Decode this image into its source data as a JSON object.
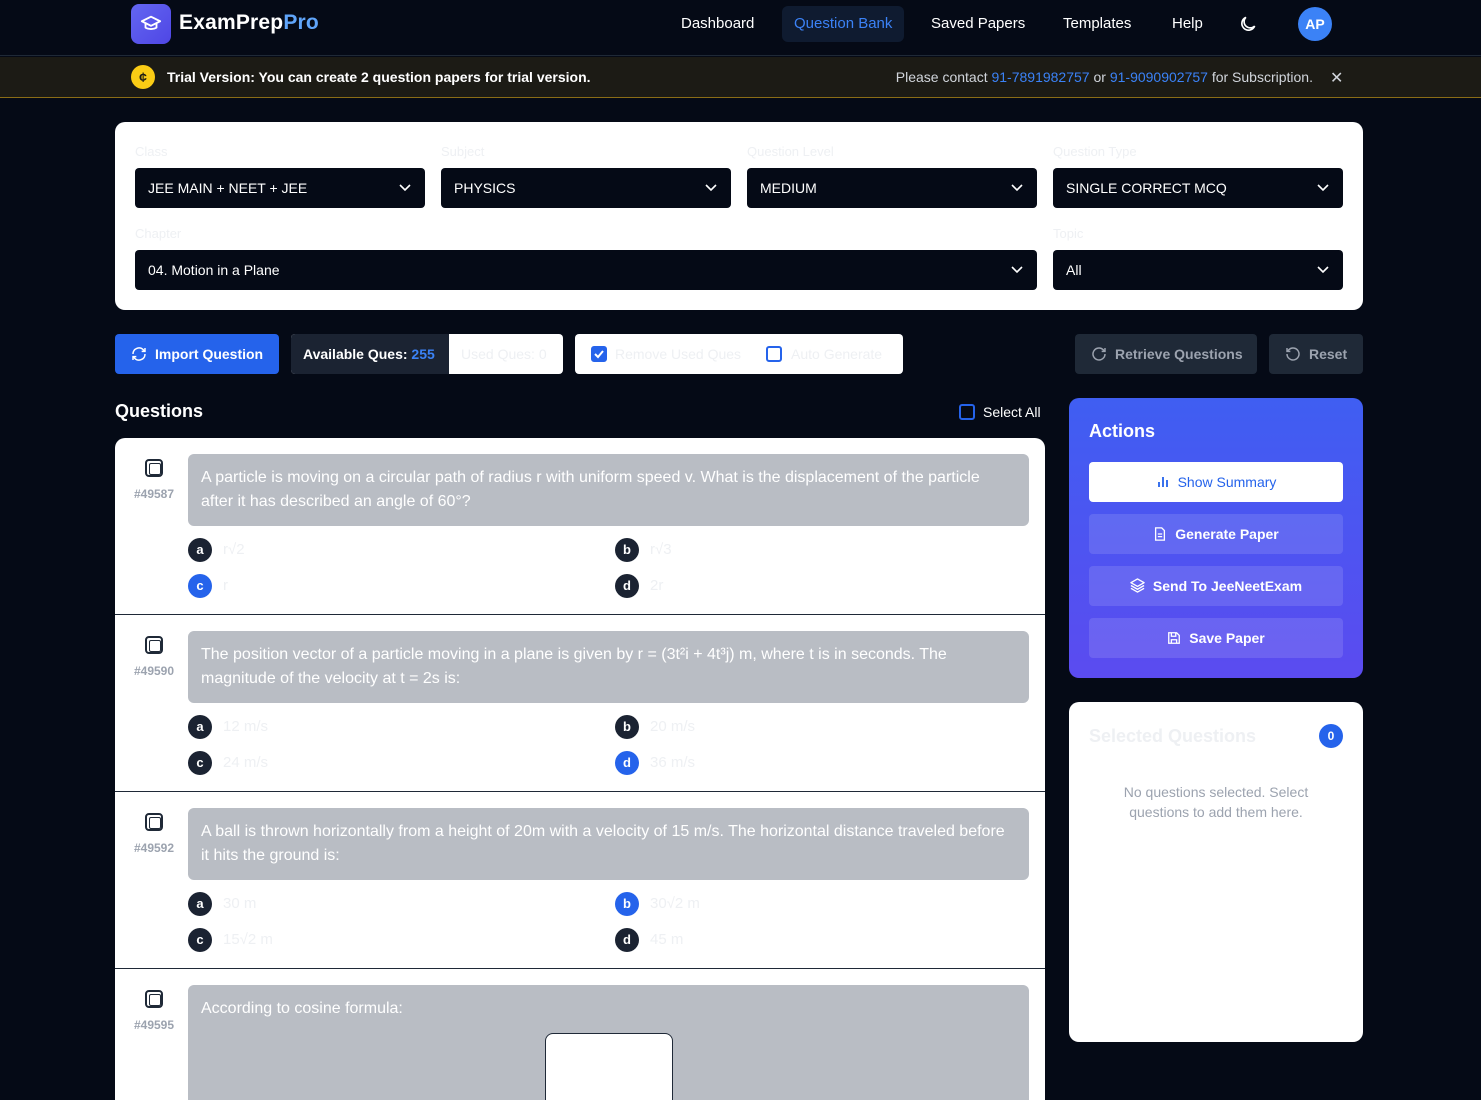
{
  "app": {
    "brand_main": "ExamPrep",
    "brand_accent": "Pro",
    "nav": [
      "Dashboard",
      "Question Bank",
      "Saved Papers",
      "Templates",
      "Help"
    ],
    "active_nav": "Question Bank",
    "avatar_initials": "AP"
  },
  "banner": {
    "icon": "coin-icon",
    "message": "Trial Version: You can create 2 question papers for trial version.",
    "contact_prefix": "Please contact ",
    "phone1": "91-7891982757",
    "contact_or": " or ",
    "phone2": "91-9090902757",
    "contact_suffix": " for Subscription."
  },
  "filters": {
    "class_label": "Class",
    "class_value": "JEE MAIN + NEET + JEE",
    "subject_label": "Subject",
    "subject_value": "PHYSICS",
    "level_label": "Question Level",
    "level_value": "MEDIUM",
    "type_label": "Question Type",
    "type_value": "SINGLE CORRECT MCQ",
    "chapter_label": "Chapter",
    "chapter_value": "04. Motion in a Plane",
    "topic_label": "Topic",
    "topic_value": "All"
  },
  "toolbar": {
    "import_label": "Import Question",
    "available_label": "Available Ques: ",
    "available_count": "255",
    "used_label": "Used Ques: 0",
    "remove_used_label": "Remove Used Ques",
    "auto_generate_label": "Auto Generate",
    "retrieve_label": "Retrieve Questions",
    "reset_label": "Reset"
  },
  "questions_header": {
    "title": "Questions",
    "select_all_label": "Select All"
  },
  "questions": [
    {
      "id": "#49587",
      "text": "A particle is moving on a circular path of radius r with uniform speed v. What is the displacement of the particle after it has described an angle of 60°?",
      "options": [
        {
          "key": "a",
          "text": "r√2",
          "correct": false
        },
        {
          "key": "b",
          "text": "r√3",
          "correct": false
        },
        {
          "key": "c",
          "text": "r",
          "correct": true
        },
        {
          "key": "d",
          "text": "2r",
          "correct": false
        }
      ]
    },
    {
      "id": "#49590",
      "text": "The position vector of a particle moving in a plane is given by r = (3t²i + 4t³j) m, where t is in seconds. The magnitude of the velocity at t = 2s is:",
      "options": [
        {
          "key": "a",
          "text": "12 m/s",
          "correct": false
        },
        {
          "key": "b",
          "text": "20 m/s",
          "correct": false
        },
        {
          "key": "c",
          "text": "24 m/s",
          "correct": false
        },
        {
          "key": "d",
          "text": "36 m/s",
          "correct": true
        }
      ]
    },
    {
      "id": "#49592",
      "text": "A ball is thrown horizontally from a height of 20m with a velocity of 15 m/s. The horizontal distance traveled before it hits the ground is:",
      "options": [
        {
          "key": "a",
          "text": "30 m",
          "correct": false
        },
        {
          "key": "b",
          "text": "30√2 m",
          "correct": true
        },
        {
          "key": "c",
          "text": "15√2 m",
          "correct": false
        },
        {
          "key": "d",
          "text": "45 m",
          "correct": false
        }
      ]
    },
    {
      "id": "#49595",
      "text": "According to cosine formula:",
      "options": []
    }
  ],
  "actions": {
    "title": "Actions",
    "show_summary": "Show Summary",
    "generate_paper": "Generate Paper",
    "send": "Send To JeeNeetExam",
    "save": "Save Paper"
  },
  "selected": {
    "title": "Selected Questions",
    "count": "0",
    "empty_text": "No questions selected. Select questions to add them here."
  },
  "colors": {
    "accent": "#2563eb",
    "background": "#050a16",
    "banner_border": "#8a6d16",
    "actions_gradient_top": "#3f5ef2",
    "actions_gradient_bottom": "#5b4bf0"
  }
}
